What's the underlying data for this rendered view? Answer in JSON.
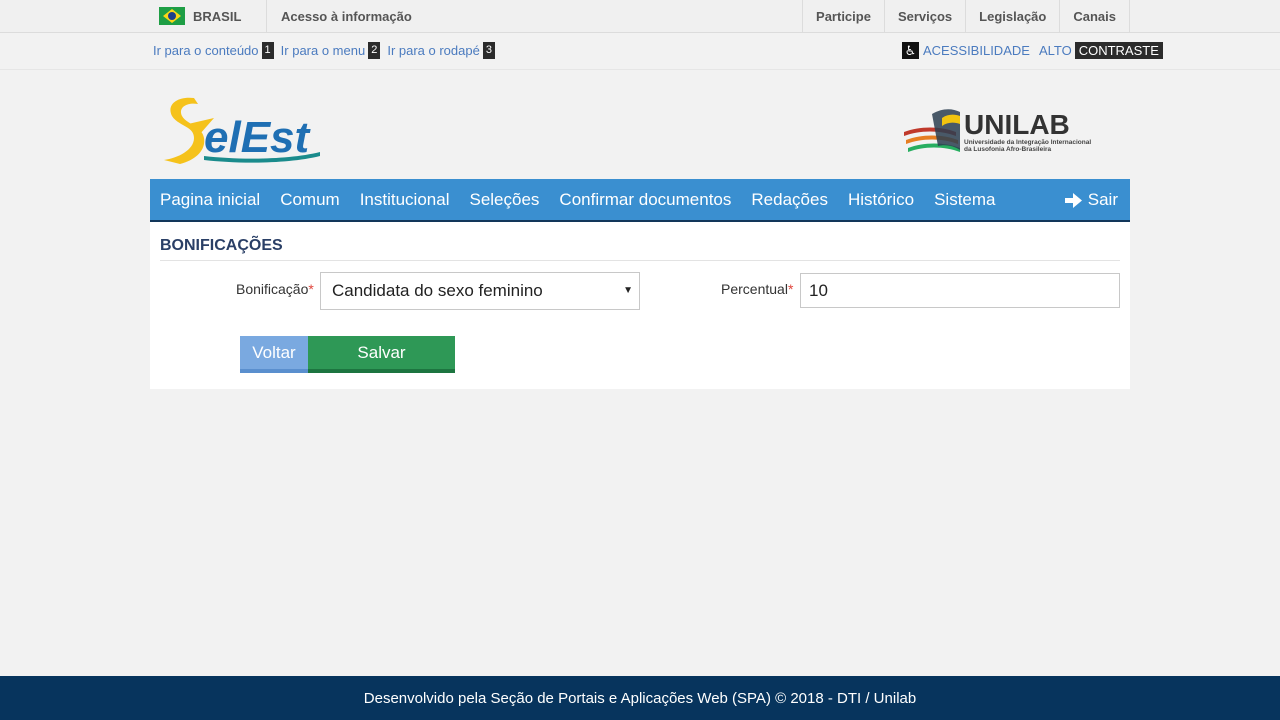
{
  "govbar": {
    "country": "BRASIL",
    "acesso": "Acesso à informação",
    "links": [
      "Participe",
      "Serviços",
      "Legislação",
      "Canais"
    ]
  },
  "skipbar": {
    "links": [
      {
        "label": "Ir para o conteúdo",
        "key": "1"
      },
      {
        "label": "Ir para o menu",
        "key": "2"
      },
      {
        "label": "Ir para o rodapé",
        "key": "3"
      }
    ],
    "acessibilidade": "ACESSIBILIDADE",
    "alto": "ALTO",
    "contraste": "CONTRASTE"
  },
  "header": {
    "app_logo": "SelEst",
    "org_logo": "UNILAB",
    "org_subtitle_1": "Universidade da Integração Internacional",
    "org_subtitle_2": "da Lusofonia Afro-Brasileira"
  },
  "nav": {
    "items": [
      "Pagina inicial",
      "Comum",
      "Institucional",
      "Seleções",
      "Confirmar documentos",
      "Redações",
      "Histórico",
      "Sistema"
    ],
    "logout": "Sair"
  },
  "form": {
    "title": "BONIFICAÇÕES",
    "bonificacao_label": "Bonificação",
    "bonificacao_value": "Candidata do sexo feminino",
    "percentual_label": "Percentual",
    "percentual_value": "10",
    "required_mark": "*",
    "back_label": "Voltar",
    "save_label": "Salvar"
  },
  "footer": {
    "text": "Desenvolvido pela Seção de Portais e Aplicações Web (SPA) © 2018 - DTI / Unilab"
  },
  "colors": {
    "nav_bg": "#3a8fd0",
    "footer_bg": "#07345d",
    "save_button": "#2e9856",
    "back_button": "#7aa9e0"
  }
}
